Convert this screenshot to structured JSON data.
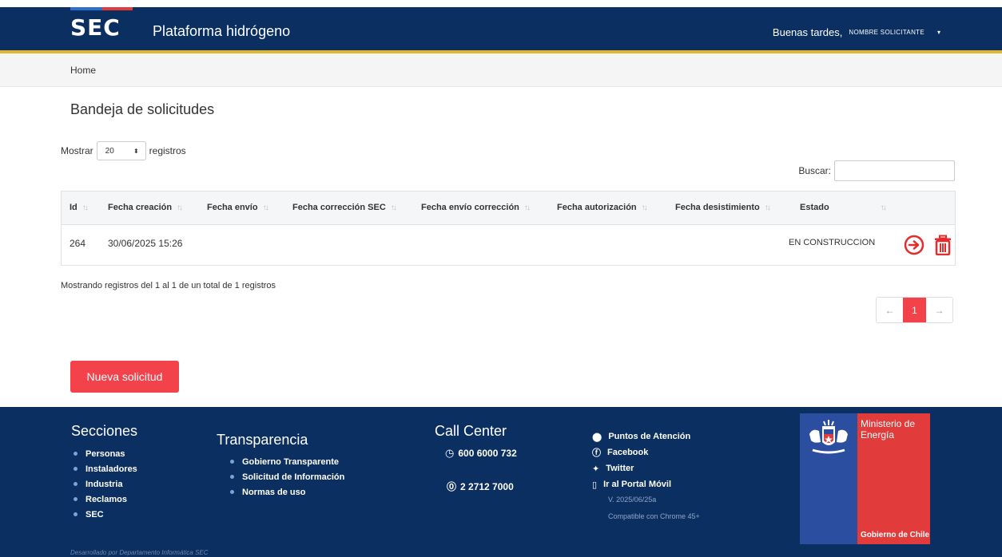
{
  "header": {
    "logo_text": "SEC",
    "app_title": "Plataforma hidrógeno",
    "greeting": "Buenas tardes,",
    "user_name": "NOMBRE SOLICITANTE",
    "user_caret": "▾"
  },
  "breadcrumb": {
    "home": "Home"
  },
  "page": {
    "title": "Bandeja de solicitudes"
  },
  "table_controls": {
    "show_label": "Mostrar",
    "page_size": "20",
    "records_label": "registros",
    "search_label": "Buscar:",
    "search_value": ""
  },
  "table": {
    "columns": [
      "Id",
      "Fecha creación",
      "Fecha envío",
      "Fecha corrección SEC",
      "Fecha envío corrección",
      "Fecha autorización",
      "Fecha desistimiento",
      "Estado"
    ],
    "rows": [
      {
        "id": "264",
        "fecha_creacion": "30/06/2025 15:26",
        "fecha_envio": "",
        "fecha_correccion_sec": "",
        "fecha_envio_correccion": "",
        "fecha_autorizacion": "",
        "fecha_desistimiento": "",
        "estado": "EN CONSTRUCCION"
      }
    ]
  },
  "info_text": "Mostrando registros del 1 al 1 de un total de 1 registros",
  "pagination": {
    "prev": "←",
    "current": "1",
    "next": "→"
  },
  "new_request_label": "Nueva solicitud",
  "footer": {
    "sections_title": "Secciones",
    "sections": [
      "Personas",
      "Instaladores",
      "Industria",
      "Reclamos",
      "SEC"
    ],
    "transparency_title": "Transparencia",
    "transparency": [
      "Gobierno Transparente",
      "Solicitud de Información",
      "Normas de uso"
    ],
    "callcenter_title": "Call Center",
    "phone_1": "600 6000 732",
    "phone_2": "2 2712 7000",
    "links": [
      "Puntos de Atención",
      "Facebook",
      "Twitter",
      "Ir al Portal Móvil"
    ],
    "version": "V. 2025/06/25a",
    "compat": "Compatible con Chrome 45+",
    "developer": "Desarrollado por Departamento Informática SEC",
    "ministry": "Ministerio de Energía",
    "government": "Gobierno de Chile"
  },
  "colors": {
    "header_bg": "#0b2f61",
    "accent_yellow": "#e0b82b",
    "action_red": "#f3424a",
    "gob_blue": "#2b4ea0",
    "gob_red": "#e23b3b"
  }
}
